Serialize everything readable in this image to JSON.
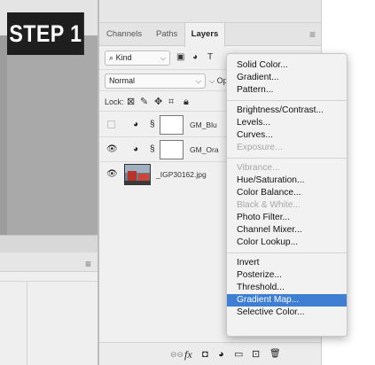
{
  "badge": {
    "label": "STEP 1"
  },
  "left_panel": {
    "menu_glyph": "≡"
  },
  "panel": {
    "tabs": [
      {
        "label": "Channels"
      },
      {
        "label": "Paths"
      },
      {
        "label": "Layers"
      }
    ],
    "menu_glyph": "≡",
    "filter": {
      "kind_value": "Kind",
      "search_glyph": "⌕",
      "chevron": "⌵",
      "icons": [
        "image-filter-icon",
        "adjustment-filter-icon",
        "type-filter-icon",
        "pin-icon"
      ]
    },
    "blend": {
      "value": "Normal",
      "opacity_label": "Opa",
      "chevron": "⌵"
    },
    "lock": {
      "label": "Lock:",
      "icons": [
        "lock-transparent-icon",
        "lock-paint-icon",
        "lock-move-icon",
        "lock-artboard-icon",
        "lock-all-icon"
      ]
    },
    "layers": [
      {
        "name": "GM_Blu",
        "visible": false,
        "type": "adjustment"
      },
      {
        "name": "GM_Ora",
        "visible": true,
        "type": "adjustment"
      },
      {
        "name": "_IGP30162.jpg",
        "visible": true,
        "type": "image"
      }
    ],
    "footer_icons": [
      "link-layers-icon",
      "fx-icon",
      "add-mask-icon",
      "adjustment-layer-icon",
      "new-group-icon",
      "new-layer-icon",
      "trash-icon"
    ],
    "footer_glyphs": {
      "link": "⊖⊖",
      "fx": "fx",
      "mask": "◘",
      "adjustment": "◕",
      "group": "▭",
      "new": "⊡",
      "trash": "🗑"
    }
  },
  "adjustment_menu": {
    "groups": [
      [
        {
          "label": "Solid Color...",
          "enabled": true
        },
        {
          "label": "Gradient...",
          "enabled": true
        },
        {
          "label": "Pattern...",
          "enabled": true
        }
      ],
      [
        {
          "label": "Brightness/Contrast...",
          "enabled": true
        },
        {
          "label": "Levels...",
          "enabled": true
        },
        {
          "label": "Curves...",
          "enabled": true
        },
        {
          "label": "Exposure...",
          "enabled": false
        }
      ],
      [
        {
          "label": "Vibrance...",
          "enabled": false
        },
        {
          "label": "Hue/Saturation...",
          "enabled": true
        },
        {
          "label": "Color Balance...",
          "enabled": true
        },
        {
          "label": "Black & White...",
          "enabled": false
        },
        {
          "label": "Photo Filter...",
          "enabled": true
        },
        {
          "label": "Channel Mixer...",
          "enabled": true
        },
        {
          "label": "Color Lookup...",
          "enabled": true
        }
      ],
      [
        {
          "label": "Invert",
          "enabled": true
        },
        {
          "label": "Posterize...",
          "enabled": true
        },
        {
          "label": "Threshold...",
          "enabled": true
        },
        {
          "label": "Gradient Map...",
          "enabled": true,
          "selected": true
        },
        {
          "label": "Selective Color...",
          "enabled": true
        }
      ]
    ],
    "highlight_color": "#3f7fd3"
  }
}
